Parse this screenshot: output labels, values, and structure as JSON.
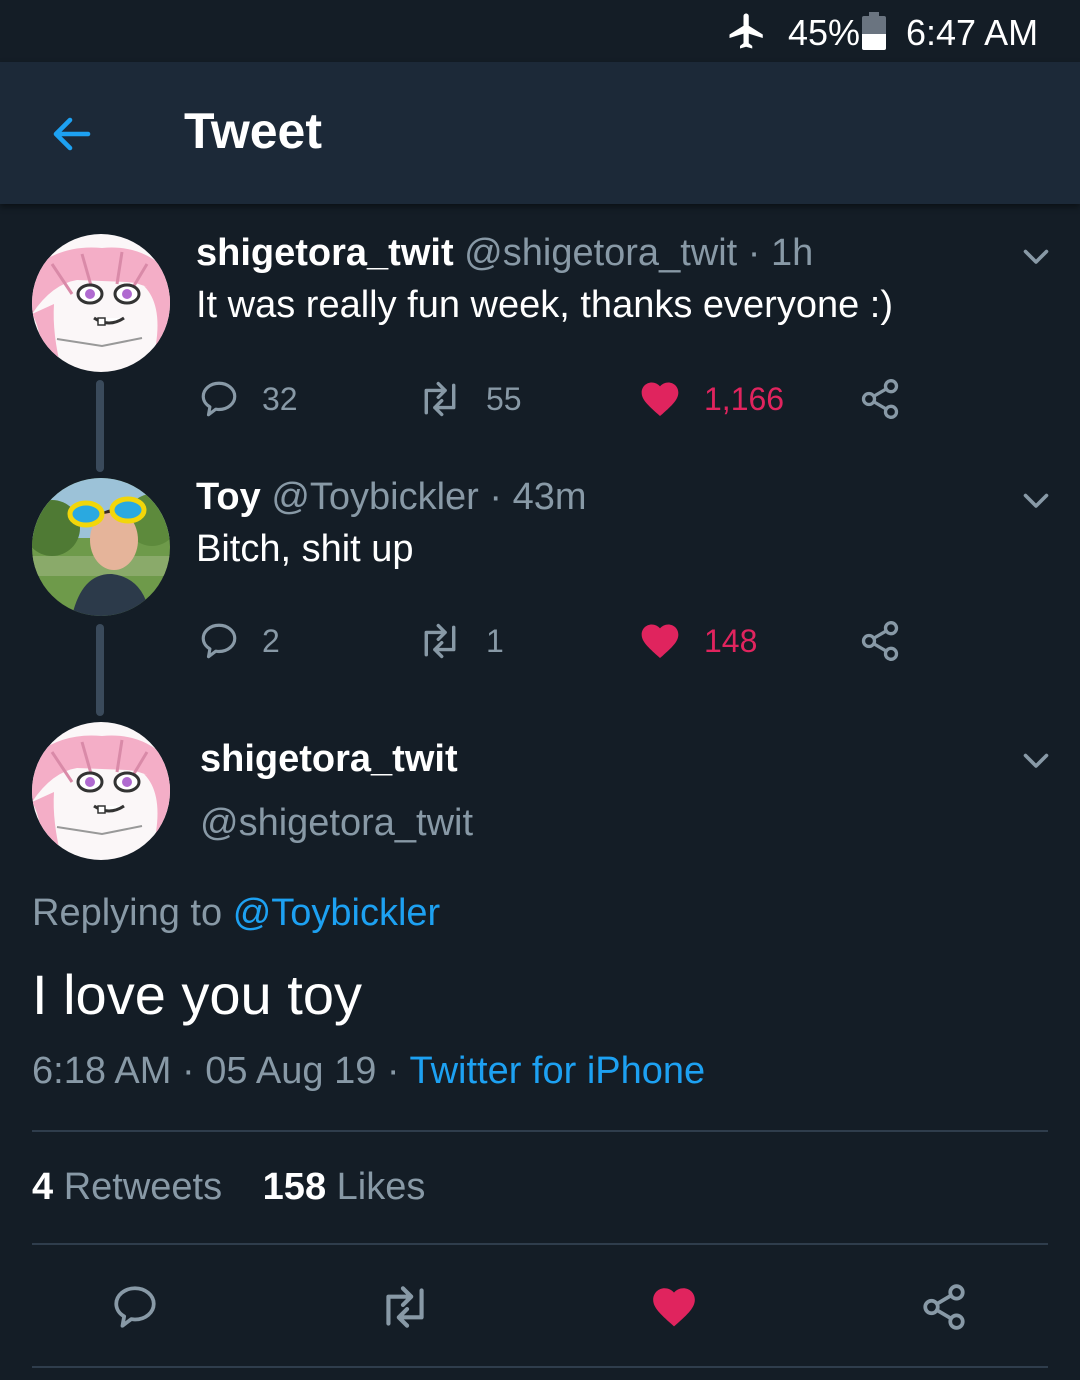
{
  "status_bar": {
    "battery": "45%",
    "time": "6:47 AM",
    "battery_level": 0.45
  },
  "app_bar": {
    "title": "Tweet"
  },
  "thread": [
    {
      "display_name": "shigetora_twit",
      "handle_time": "@shigetora_twit · 1h",
      "text": "It was really fun week, thanks everyone :)",
      "replies": "32",
      "retweets": "55",
      "likes": "1,166",
      "liked": true
    },
    {
      "display_name": "Toy",
      "handle_time": "@Toybickler · 43m",
      "text": "Bitch, shit up",
      "replies": "2",
      "retweets": "1",
      "likes": "148",
      "liked": true
    }
  ],
  "main_tweet": {
    "display_name": "shigetora_twit",
    "handle": "@shigetora_twit",
    "replying_prefix": "Replying to",
    "replying_handle": "@Toybickler",
    "text": "I love you toy",
    "timestamp": "6:18 AM · 05 Aug 19 ·",
    "client": "Twitter for iPhone",
    "retweet_count": "4",
    "retweet_label": "Retweets",
    "like_count": "158",
    "like_label": "Likes",
    "liked": true
  },
  "colors": {
    "background": "#141d26",
    "app_bar": "#1c2938",
    "secondary_text": "#8899a6",
    "accent_blue": "#1da1f2",
    "like_red": "#e0245e"
  }
}
